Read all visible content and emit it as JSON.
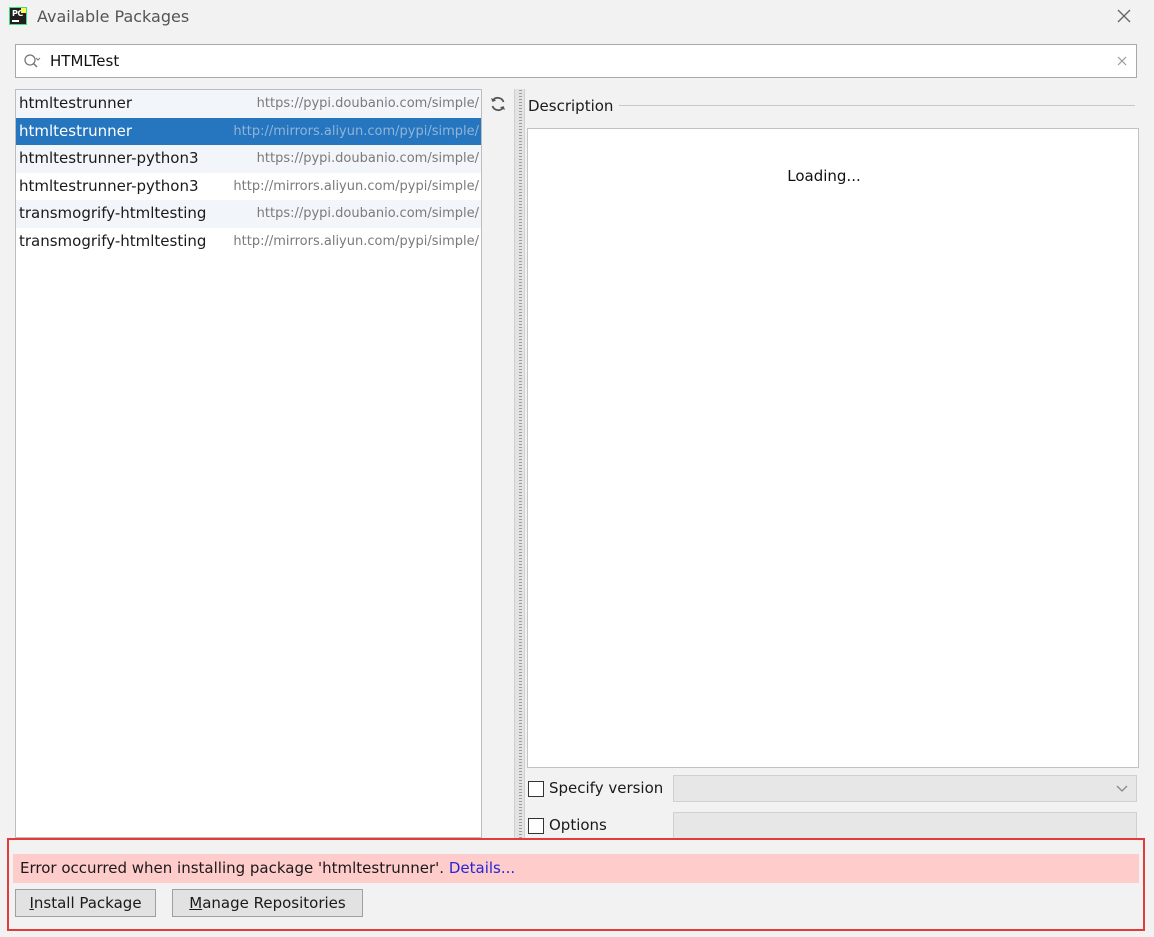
{
  "window": {
    "title": "Available Packages",
    "app_icon_letters": "PC"
  },
  "search": {
    "value": "HTMLTest"
  },
  "packages": [
    {
      "name": "htmltestrunner",
      "repo": "https://pypi.doubanio.com/simple/"
    },
    {
      "name": "htmltestrunner",
      "repo": "http://mirrors.aliyun.com/pypi/simple/",
      "selected": true
    },
    {
      "name": "htmltestrunner-python3",
      "repo": "https://pypi.doubanio.com/simple/"
    },
    {
      "name": "htmltestrunner-python3",
      "repo": "http://mirrors.aliyun.com/pypi/simple/"
    },
    {
      "name": "transmogrify-htmltesting",
      "repo": "https://pypi.doubanio.com/simple/"
    },
    {
      "name": "transmogrify-htmltesting",
      "repo": "http://mirrors.aliyun.com/pypi/simple/"
    }
  ],
  "description": {
    "label": "Description",
    "content": "Loading..."
  },
  "options": {
    "specify_version_label": "Specify version",
    "options_label": "Options"
  },
  "error": {
    "message": "Error occurred when installing package 'htmltestrunner'.",
    "details_link": "Details..."
  },
  "buttons": {
    "install": {
      "accel": "I",
      "rest": "nstall Package"
    },
    "manage": {
      "accel": "M",
      "rest": "anage Repositories"
    }
  },
  "colors": {
    "selection": "#2675bf",
    "error_bg": "#ffcccc",
    "highlight_border": "#e03c3c",
    "link": "#2626d4"
  }
}
